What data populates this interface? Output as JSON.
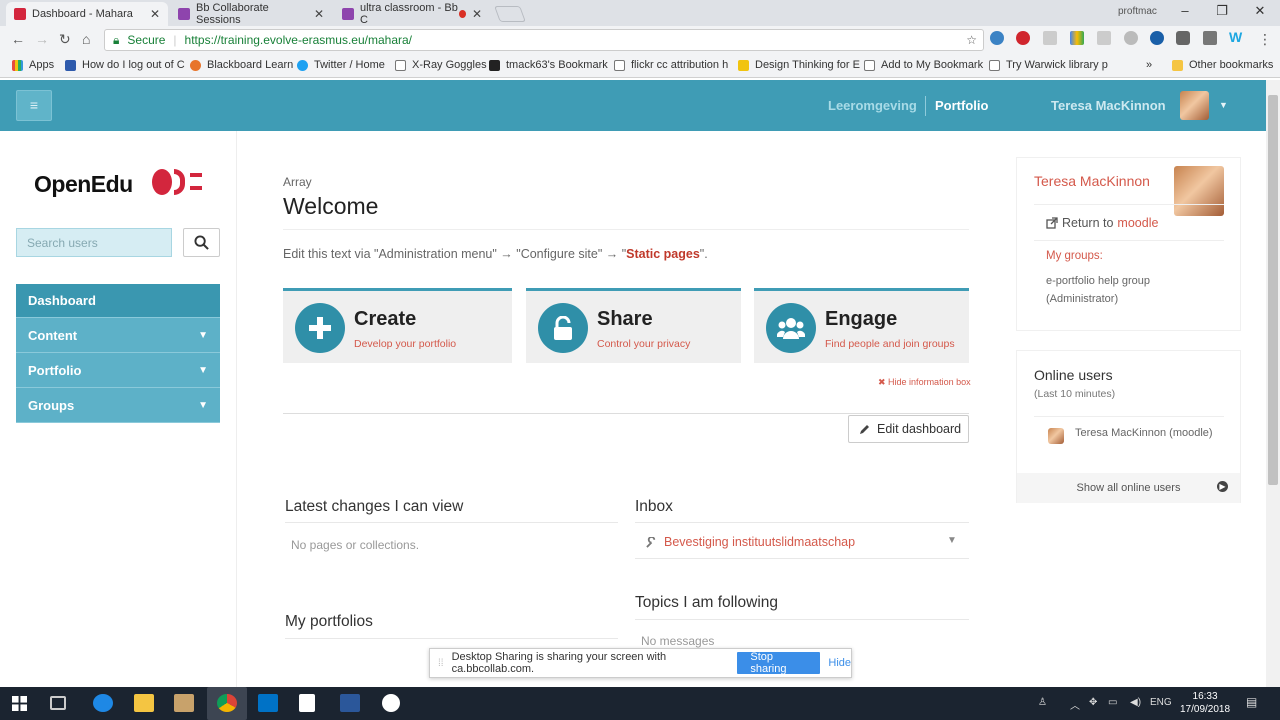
{
  "browser": {
    "tabs": [
      {
        "title": "Dashboard - Mahara"
      },
      {
        "title": "Bb Collaborate Sessions"
      },
      {
        "title": "ultra classroom - Bb C"
      }
    ],
    "window_user": "proftmac",
    "secure_label": "Secure",
    "url": "https://training.evolve-erasmus.eu/mahara/",
    "bookmarks": [
      "Apps",
      "How do I log out of C",
      "Blackboard Learn",
      "Twitter / Home",
      "X-Ray Goggles",
      "tmack63's Bookmark",
      "flickr cc attribution h",
      "Design Thinking for E",
      "Add to My Bookmark",
      "Try Warwick library p"
    ],
    "other_bookmarks": "Other bookmarks",
    "more_bookmarks": "»"
  },
  "header": {
    "nav": [
      "Leeromgeving",
      "Portfolio"
    ],
    "user_name": "Teresa MacKinnon"
  },
  "sidebar": {
    "logo_text": "OpenEdu",
    "search_placeholder": "Search users",
    "menu": [
      {
        "label": "Dashboard",
        "expandable": false
      },
      {
        "label": "Content",
        "expandable": true
      },
      {
        "label": "Portfolio",
        "expandable": true
      },
      {
        "label": "Groups",
        "expandable": true
      }
    ]
  },
  "main": {
    "breadcrumb": "Array",
    "title": "Welcome",
    "edit_text_prefix": "Edit this text via \"Administration menu\" → \"Configure site\" → \"",
    "edit_text_link": "Static pages",
    "edit_text_suffix": "\".",
    "cards": [
      {
        "title": "Create",
        "subtitle": "Develop your portfolio",
        "icon": "plus-icon"
      },
      {
        "title": "Share",
        "subtitle": "Control your privacy",
        "icon": "unlock-icon"
      },
      {
        "title": "Engage",
        "subtitle": "Find people and join groups",
        "icon": "users-icon"
      }
    ],
    "hide_info": "Hide information box",
    "edit_dashboard": "Edit dashboard",
    "latest_changes": {
      "title": "Latest changes I can view",
      "empty": "No pages or collections."
    },
    "inbox": {
      "title": "Inbox",
      "item": "Bevestiging instituutslidmaatschap"
    },
    "my_portfolios": {
      "title": "My portfolios"
    },
    "topics": {
      "title": "Topics I am following",
      "empty": "No messages"
    }
  },
  "profile": {
    "name": "Teresa MacKinnon",
    "return_prefix": "Return to",
    "return_link": "moodle",
    "groups_label": "My groups:",
    "groups": [
      "e-portfolio help group",
      "(Administrator)"
    ]
  },
  "online": {
    "title": "Online users",
    "subtitle": "(Last 10 minutes)",
    "user": "Teresa MacKinnon (moodle)",
    "show_all": "Show all online users"
  },
  "sharing": {
    "message": "Desktop Sharing is sharing your screen with ca.bbcollab.com.",
    "stop": "Stop sharing",
    "hide": "Hide"
  },
  "taskbar": {
    "lang": "ENG",
    "time": "16:33",
    "date": "17/09/2018"
  },
  "colors": {
    "brand": "#3f9cb5",
    "accent": "#d4594b",
    "logo": "#d3263d"
  }
}
